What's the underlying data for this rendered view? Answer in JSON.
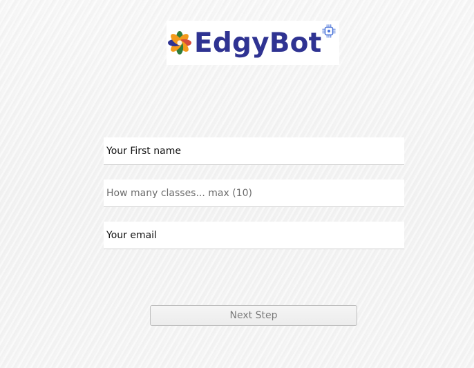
{
  "logo": {
    "text": "EdgyBot",
    "colors": {
      "text": "#2f3392",
      "petal_orange": "#f39a1b",
      "petal_green": "#2f7d3a",
      "petal_blue": "#2f3392",
      "petal_red": "#d64a3a",
      "chip": "#4a73d8"
    },
    "icons": [
      "flower-logo-icon",
      "ai-chip-icon"
    ]
  },
  "form": {
    "first_name": {
      "placeholder": "Your First name",
      "value": ""
    },
    "classes": {
      "placeholder": "How many classes... max (10)",
      "value": ""
    },
    "email": {
      "placeholder": "Your email",
      "value": ""
    }
  },
  "actions": {
    "next_step_label": "Next Step"
  }
}
